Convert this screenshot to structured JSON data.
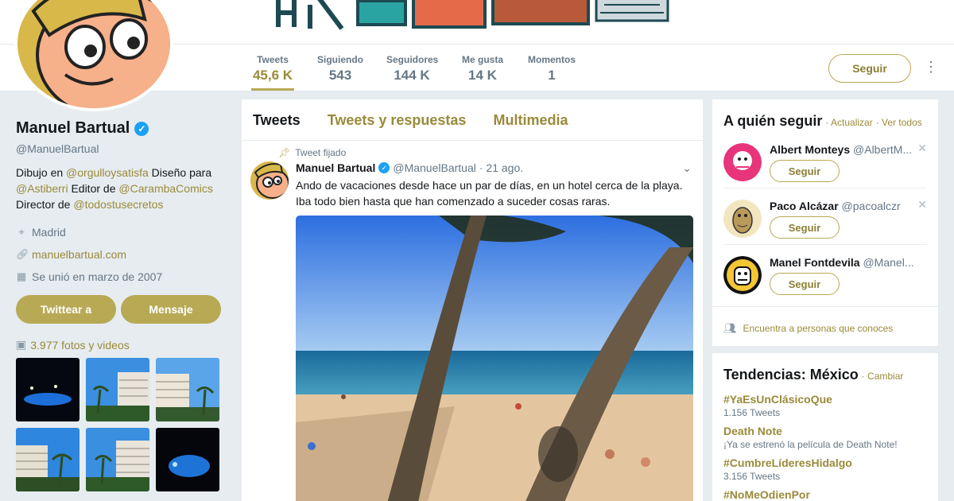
{
  "profile_nav": {
    "stats": [
      {
        "label": "Tweets",
        "value": "45,6 K"
      },
      {
        "label": "Siguiendo",
        "value": "543"
      },
      {
        "label": "Seguidores",
        "value": "144 K"
      },
      {
        "label": "Me gusta",
        "value": "14 K"
      },
      {
        "label": "Momentos",
        "value": "1"
      }
    ],
    "follow_label": "Seguir",
    "more_icon": "more-vertical-icon"
  },
  "profile": {
    "name": "Manuel Bartual",
    "handle": "@ManuelBartual",
    "bio": {
      "p1": "Dibujo en ",
      "l1": "@orgulloysatisfa",
      "p2": " Diseño para ",
      "l2": "@Astiberri",
      "p3": " Editor de ",
      "l3": "@CarambaComics",
      "p4": "Director de ",
      "l4": "@todostusecretos"
    },
    "location": "Madrid",
    "website": "manuelbartual.com",
    "joined": "Se unió en marzo de 2007",
    "tweet_to": "Twittear a",
    "message": "Mensaje",
    "media_count": "3.977 fotos y videos"
  },
  "timeline": {
    "tabs": [
      "Tweets",
      "Tweets y respuestas",
      "Multimedia"
    ],
    "tweet": {
      "pinned": "Tweet fijado",
      "name": "Manuel Bartual",
      "handle": "@ManuelBartual",
      "date": "· 21 ago.",
      "text_line1": "Ando de vacaciones desde hace un par de días, en un hotel cerca de la playa.",
      "text_line2": "Iba todo bien hasta que han comenzado a suceder cosas raras."
    }
  },
  "who_to_follow": {
    "title": "A quién seguir",
    "refresh": "· Actualizar",
    "view_all": "· Ver todos",
    "suggestions": [
      {
        "name": "Albert Monteys",
        "handle": "@AlbertM...",
        "button": "Seguir"
      },
      {
        "name": "Paco Alcázar",
        "handle": "@pacoalczr",
        "button": "Seguir"
      },
      {
        "name": "Manel Fontdevila",
        "handle": "@Manel...",
        "button": "Seguir"
      }
    ],
    "find_people": "Encuentra a personas que conoces"
  },
  "trends": {
    "title": "Tendencias: México",
    "change": "· Cambiar",
    "items": [
      {
        "title": "#YaEsUnClásicoQue",
        "sub": "1.156 Tweets"
      },
      {
        "title": "Death Note",
        "sub": "¡Ya se estrenó la película de Death Note!"
      },
      {
        "title": "#CumbreLíderesHidalgo",
        "sub": "3.156 Tweets"
      },
      {
        "title": "#NoMeOdienPor",
        "sub": ""
      }
    ]
  },
  "colors": {
    "accent": "#b8a955",
    "accent_text": "#9a8a3a",
    "verified": "#1da1f2",
    "background": "#e6ecf0"
  }
}
